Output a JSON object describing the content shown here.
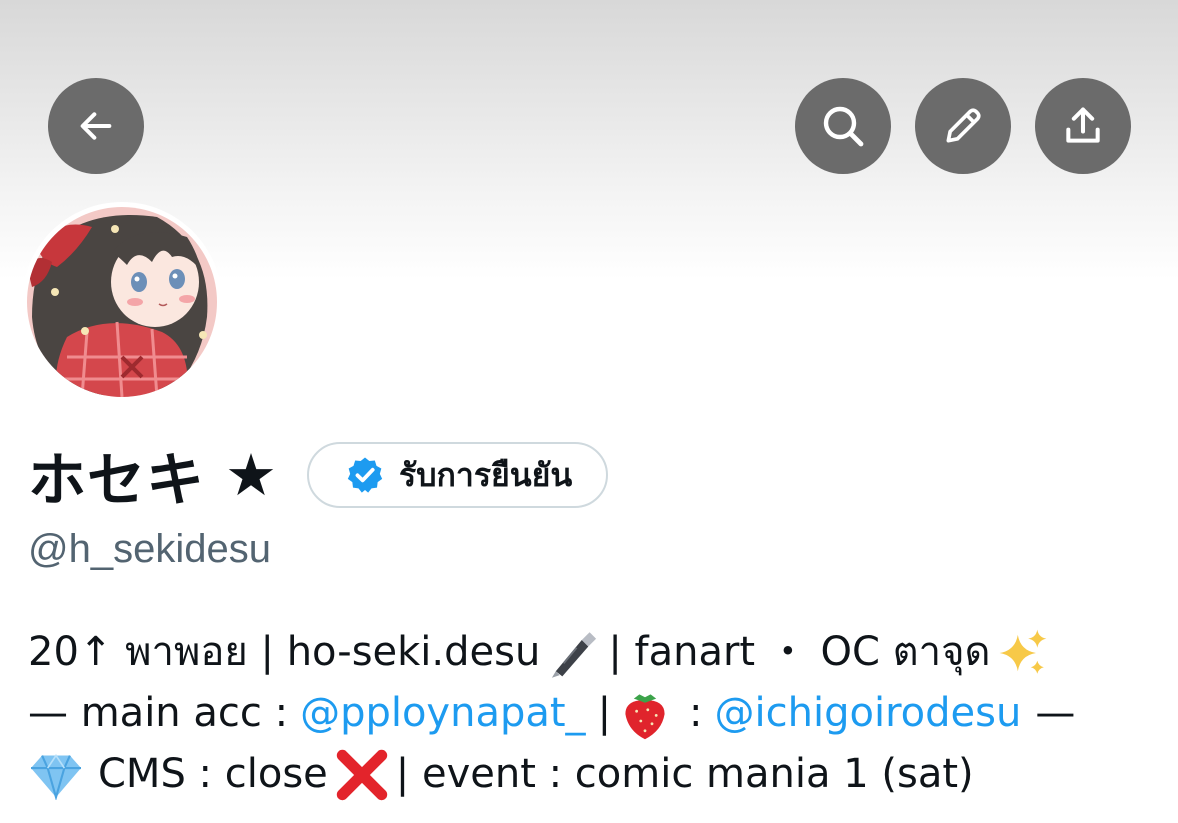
{
  "profile": {
    "display_name": "ホセキ",
    "name_star": "★",
    "verified_label": "รับการยืนยัน",
    "handle": "@h_sekidesu"
  },
  "bio": {
    "line1": {
      "part1": "20↑ พาพอย | ho-seki.desu",
      "pen_emoji": "fountain-pen-emoji",
      "part2": "| fanart ・ OC ตาจุด",
      "sparkle_emoji": "sparkles-emoji"
    },
    "line2": {
      "part1": "— main acc :",
      "mention1": "@pploynapat_",
      "sep": "|",
      "strawberry_emoji": "strawberry-emoji",
      "colon": ":",
      "mention2": "@ichigoirodesu",
      "part2": "—"
    },
    "line3": {
      "diamond_emoji": "gem-emoji",
      "part1": "CMS : close",
      "cross_emoji": "cross-mark-emoji",
      "part2": "| event : comic mania 1 (sat)"
    }
  },
  "icons": {
    "back": "arrow-left-icon",
    "search": "search-icon",
    "edit": "pencil-icon",
    "share": "share-icon",
    "verified": "verified-badge-icon"
  },
  "colors": {
    "accent": "#1d9bf0",
    "button_bg": "#6b6b6b",
    "handle": "#536471",
    "text": "#0f1419"
  }
}
